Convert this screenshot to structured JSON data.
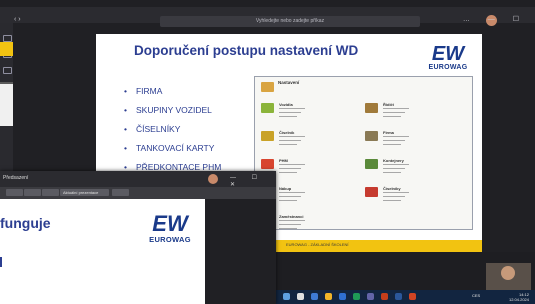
{
  "back_window": {
    "search_placeholder": "Vyhledejte nebo zadejte příkaz",
    "slide": {
      "title": "Doporučení postupu nastavení WD",
      "logo_mark": "EW",
      "logo_name": "EUROWAG",
      "bullets": [
        "FIRMA",
        "SKUPINY VOZIDEL",
        "ČÍSELNÍKY",
        "TANKOVACÍ KARTY",
        "PŘEDKONTACE PHM"
      ],
      "panel": {
        "header": "Nastavení",
        "modules": [
          {
            "title": "Vozidla",
            "color": "#8bb43a"
          },
          {
            "title": "Číselník",
            "color": "#c9a227"
          },
          {
            "title": "PHM",
            "color": "#d8452f"
          },
          {
            "title": "Nákup",
            "color": "#e28a1f"
          },
          {
            "title": "Zaměstnanci",
            "color": "#6f8fb8"
          },
          {
            "title": "Řidiči",
            "color": "#a07a3a"
          },
          {
            "title": "Firma",
            "color": "#8a7a55"
          },
          {
            "title": "Kontejnery",
            "color": "#5a8a3a"
          },
          {
            "title": "Číselníky",
            "color": "#c63b2f"
          }
        ]
      },
      "footer": "EUROWAG - ZÁKLADNÍ ŠKOLENÍ"
    }
  },
  "front_window": {
    "title": "Předsazení",
    "toolbar_value": "Aktuální prezentace",
    "slide": {
      "title": "funguje",
      "logo_mark": "EW",
      "logo_name": "EUROWAG"
    }
  },
  "taskbar": {
    "time": "14:12",
    "date": "12.04.2024",
    "lang": "CES"
  },
  "colors": {
    "brand": "#2c3e91",
    "accent": "#f2c311"
  }
}
